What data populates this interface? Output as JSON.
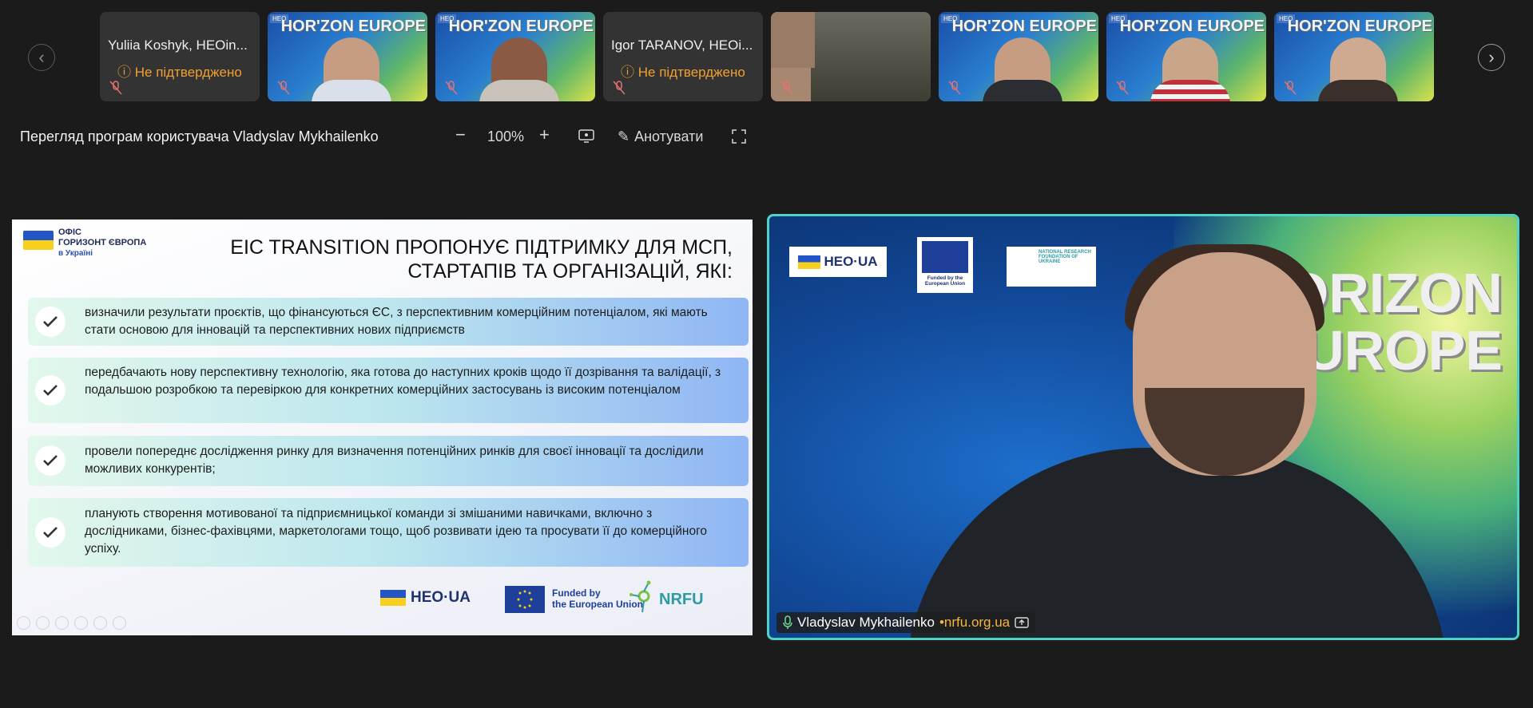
{
  "participants": [
    {
      "name": "Yuliia Koshyk, HEOin...",
      "status": "Не підтверджено",
      "type": "noname"
    },
    {
      "name": "",
      "type": "video"
    },
    {
      "name": "",
      "type": "video"
    },
    {
      "name": "Igor  TARANOV, HEOi...",
      "status": "Не підтверджено",
      "type": "noname"
    },
    {
      "name": "",
      "type": "room"
    },
    {
      "name": "",
      "type": "video"
    },
    {
      "name": "",
      "type": "video"
    },
    {
      "name": "",
      "type": "video"
    }
  ],
  "tile_logo": "HEO",
  "tile_brand": "HOR'ZON EUROPE",
  "viewer": {
    "title": "Перегляд програм користувача Vladyslav Mykhailenko",
    "zoom": "100%",
    "annotate_label": "Анотувати"
  },
  "slide": {
    "office_logo": {
      "line1": "ОФІС",
      "line2": "ГОРИЗОНТ ЄВРОПА",
      "line3": "в Україні"
    },
    "heading_line1": "EIC TRANSITION ПРОПОНУЄ ПІДТРИМКУ ДЛЯ МСП,",
    "heading_line2": "СТАРТАПІВ ТА ОРГАНІЗАЦІЙ, ЯКІ:",
    "bullets": [
      "визначили результати проєктів, що фінансуються ЄС, з перспективним комерційним потенціалом, які мають стати основою для інновацій та перспективних нових підприємств",
      "передбачають нову перспективну технологію, яка готова до наступних кроків щодо її дозрівання та валідації, з подальшою розробкою та перевіркою для конкретних комерційних застосувань із високим потенціалом",
      "провели попереднє дослідження ринку для визначення потенційних ринків для своєї інновації та дослідили можливих конкурентів;",
      "планують створення мотивованої та підприємницької команди зі змішаними навичками, включно з дослідниками, бізнес-фахівцями, маркетологами тощо, щоб розвивати ідею та просувати її до комерційного успіху."
    ],
    "footer": {
      "heo": "HEO·UA",
      "eu_line1": "Funded by",
      "eu_line2": "the European Union",
      "nrfu": "NRFU"
    }
  },
  "speaker": {
    "name": "Vladyslav Mykhailenko",
    "site": "nrfu.org.ua",
    "logo_heo": "HEO·UA",
    "logo_eu": "Funded by the European Union",
    "logo_nrf": "NATIONAL RESEARCH FOUNDATION OF UKRAINE",
    "brand_line1": "ORIZON",
    "brand_line2": "UROPE"
  },
  "colors": {
    "status": "#f0a030",
    "speaker_border": "#4fd1c5",
    "site": "#f5b53d"
  }
}
